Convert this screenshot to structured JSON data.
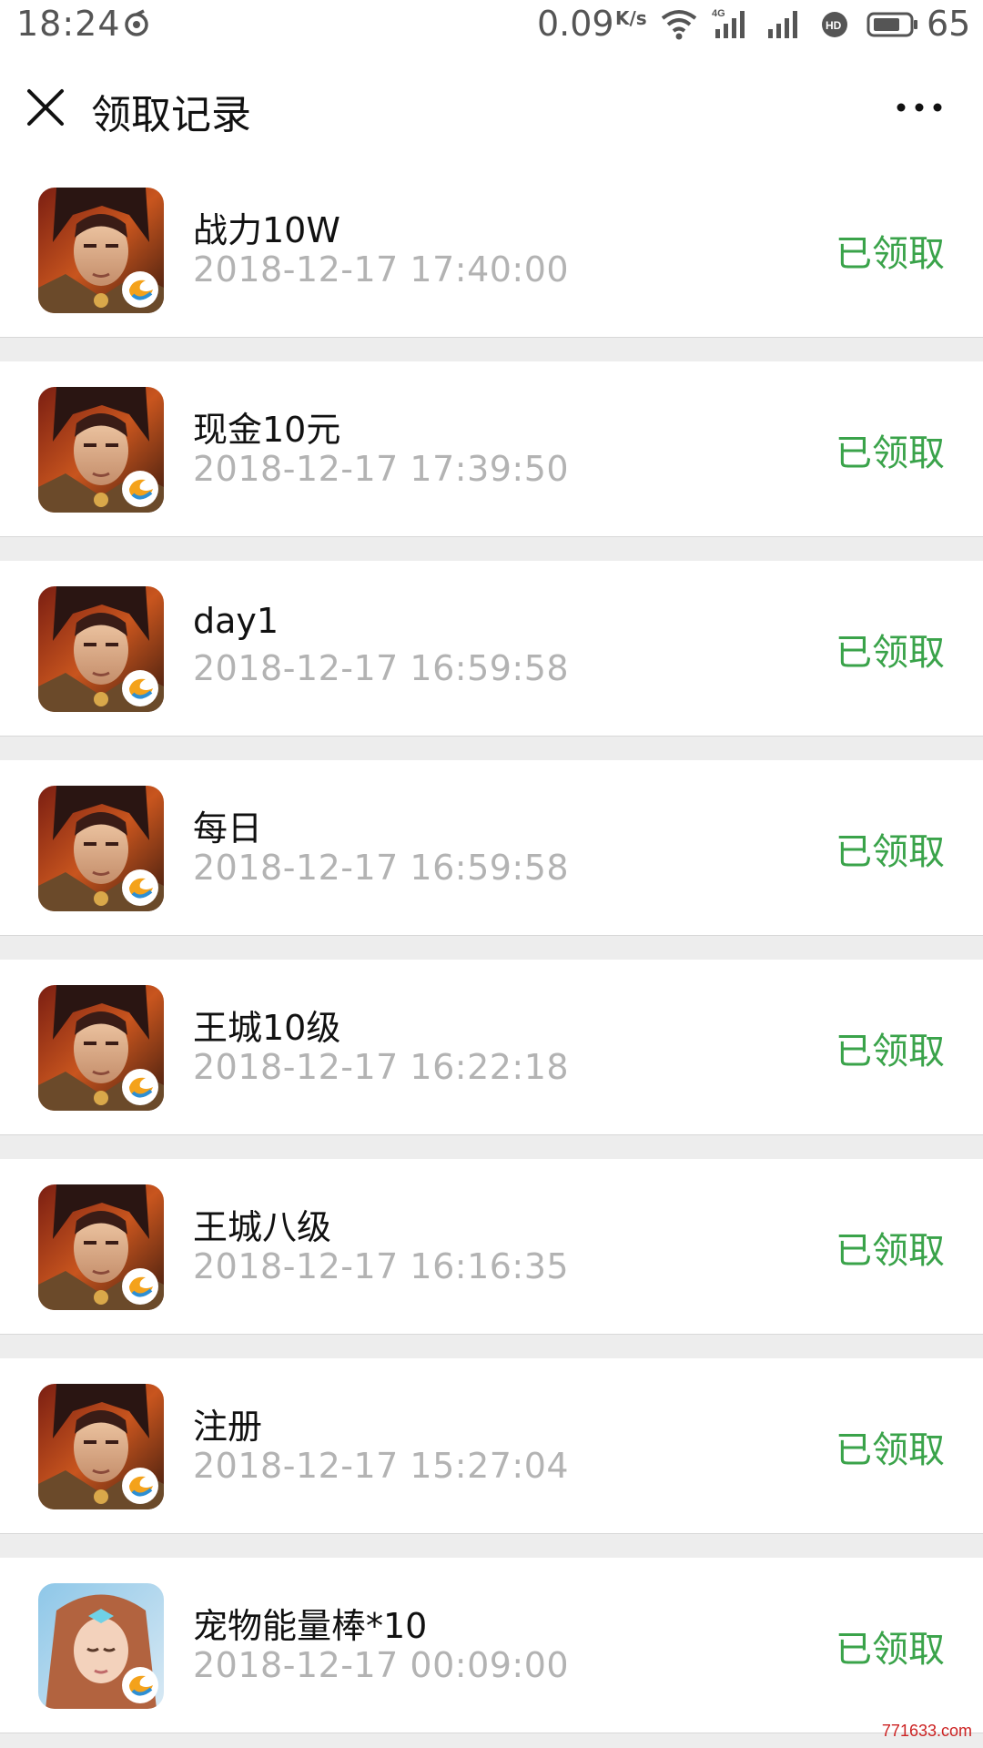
{
  "status_bar": {
    "time": "18:24",
    "net_speed": "0.09",
    "net_unit": "K/s",
    "battery_level": "65"
  },
  "nav": {
    "title": "领取记录"
  },
  "colors": {
    "status_claimed": "#3aa34a"
  },
  "records": [
    {
      "title": "战力10W",
      "time": "2018-12-17 17:40:00",
      "status": "已领取",
      "icon": "game-warrior-icon"
    },
    {
      "title": "现金10元",
      "time": "2018-12-17 17:39:50",
      "status": "已领取",
      "icon": "game-warrior-icon"
    },
    {
      "title": "day1",
      "time": "2018-12-17 16:59:58",
      "status": "已领取",
      "icon": "game-warrior-icon"
    },
    {
      "title": "每日",
      "time": "2018-12-17 16:59:58",
      "status": "已领取",
      "icon": "game-warrior-icon"
    },
    {
      "title": "王城10级",
      "time": "2018-12-17 16:22:18",
      "status": "已领取",
      "icon": "game-warrior-icon"
    },
    {
      "title": "王城八级",
      "time": "2018-12-17 16:16:35",
      "status": "已领取",
      "icon": "game-warrior-icon"
    },
    {
      "title": "注册",
      "time": "2018-12-17 15:27:04",
      "status": "已领取",
      "icon": "game-warrior-icon"
    },
    {
      "title": "宠物能量棒*10",
      "time": "2018-12-17 00:09:00",
      "status": "已领取",
      "icon": "game-fairy-icon"
    }
  ],
  "watermark": "771633.com"
}
